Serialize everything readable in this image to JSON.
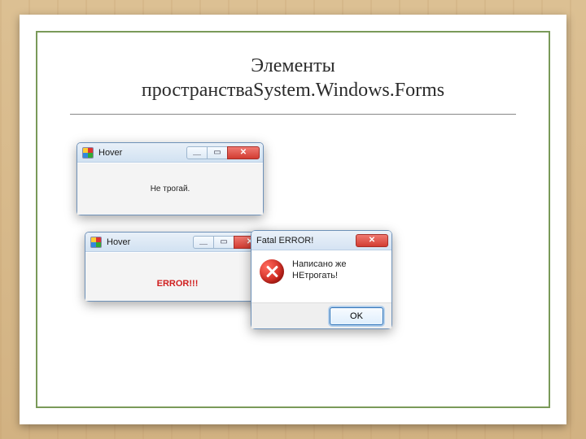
{
  "title": {
    "line1": "Элементы",
    "line2": "пространстваSystem.Windows.Forms"
  },
  "window1": {
    "title": "Hover",
    "message": "Не трогай.",
    "close_glyph": "✕",
    "min_glyph": "＿",
    "max_glyph": "▭"
  },
  "window2": {
    "title": "Hover",
    "message": "ERROR!!!",
    "close_glyph": "✕",
    "min_glyph": "＿",
    "max_glyph": "▭"
  },
  "dialog": {
    "title": "Fatal ERROR!",
    "line1": "Написано же",
    "line2": "НЕтрогать!",
    "ok_label": "OK",
    "close_glyph": "✕"
  }
}
